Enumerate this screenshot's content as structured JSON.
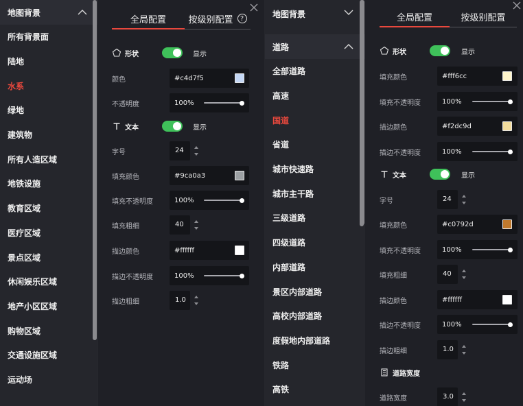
{
  "colors": {
    "accent": "#e8483d",
    "switch_on": "#3fc15a"
  },
  "left_nav": {
    "header": "地图背景",
    "header_icon": "chevron-up-icon",
    "items": [
      "所有背景面",
      "陆地",
      "水系",
      "绿地",
      "建筑物",
      "所有人造区域",
      "地铁设施",
      "教育区域",
      "医疗区域",
      "景点区域",
      "休闲娱乐区域",
      "地产小区区域",
      "购物区域",
      "交通设施区域",
      "运动场"
    ],
    "active_index": 2
  },
  "left_settings": {
    "tabs": [
      {
        "label": "全局配置"
      },
      {
        "label": "按级别配置"
      }
    ],
    "shape": {
      "title": "形状",
      "icon": "pentagon-icon",
      "toggle_label": "显示",
      "color_label": "颜色",
      "color_value": "#c4d7f5",
      "color_swatch": "#c4d7f5",
      "opacity_label": "不透明度",
      "opacity_value": "100%"
    },
    "text": {
      "title": "文本",
      "icon": "text-t-icon",
      "toggle_label": "显示",
      "size_label": "字号",
      "size_value": "24",
      "fill_color_label": "填充颜色",
      "fill_color_value": "#9ca0a3",
      "fill_color_swatch": "#9ca0a3",
      "fill_opacity_label": "填充不透明度",
      "fill_opacity_value": "100%",
      "fill_weight_label": "填充粗细",
      "fill_weight_value": "40",
      "stroke_color_label": "描边颜色",
      "stroke_color_value": "#ffffff",
      "stroke_color_swatch": "#ffffff",
      "stroke_opacity_label": "描边不透明度",
      "stroke_opacity_value": "100%",
      "stroke_width_label": "描边粗细",
      "stroke_width_value": "1.0"
    }
  },
  "right_nav": {
    "group1": {
      "header": "地图背景",
      "icon": "chevron-down-icon"
    },
    "group2": {
      "header": "道路",
      "icon": "chevron-up-icon"
    },
    "items": [
      "全部道路",
      "高速",
      "国道",
      "省道",
      "城市快速路",
      "城市主干路",
      "三级道路",
      "四级道路",
      "内部道路",
      "景区内部道路",
      "高校内部道路",
      "度假地内部道路",
      "铁路",
      "高铁"
    ],
    "active_index": 2
  },
  "right_settings": {
    "tabs": [
      {
        "label": "全局配置"
      },
      {
        "label": "按级别配置"
      }
    ],
    "shape": {
      "title": "形状",
      "icon": "pentagon-icon",
      "toggle_label": "显示",
      "fill_color_label": "填充颜色",
      "fill_color_value": "#fff6cc",
      "fill_color_swatch": "#fff6cc",
      "fill_opacity_label": "填充不透明度",
      "stroke_color_label": "描边颜色",
      "stroke_color_value": "#f2dc9d",
      "stroke_color_swatch": "#f2dc9d",
      "stroke_opacity_label": "描边不透明度"
    },
    "text": {
      "title": "文本",
      "icon": "text-t-icon",
      "toggle_label": "显示",
      "size_label": "字号",
      "size_value": "24",
      "fill_color_label": "填充颜色",
      "fill_color_value": "#c0792d",
      "fill_color_swatch": "#c0792d",
      "fill_opacity_label": "填充不透明度",
      "fill_opacity_value": "100%",
      "fill_weight_label": "填充粗细",
      "fill_weight_value": "40",
      "stroke_color_label": "描边颜色",
      "stroke_color_value": "#ffffff",
      "stroke_color_swatch": "#ffffff",
      "stroke_opacity_label": "描边不透明度",
      "stroke_opacity_value": "100%",
      "stroke_width_label": "描边粗细",
      "stroke_width_value": "1.0"
    },
    "road_width": {
      "title": "道路宽度",
      "icon": "road-width-icon",
      "label": "道路宽度",
      "value": "3.0"
    }
  }
}
